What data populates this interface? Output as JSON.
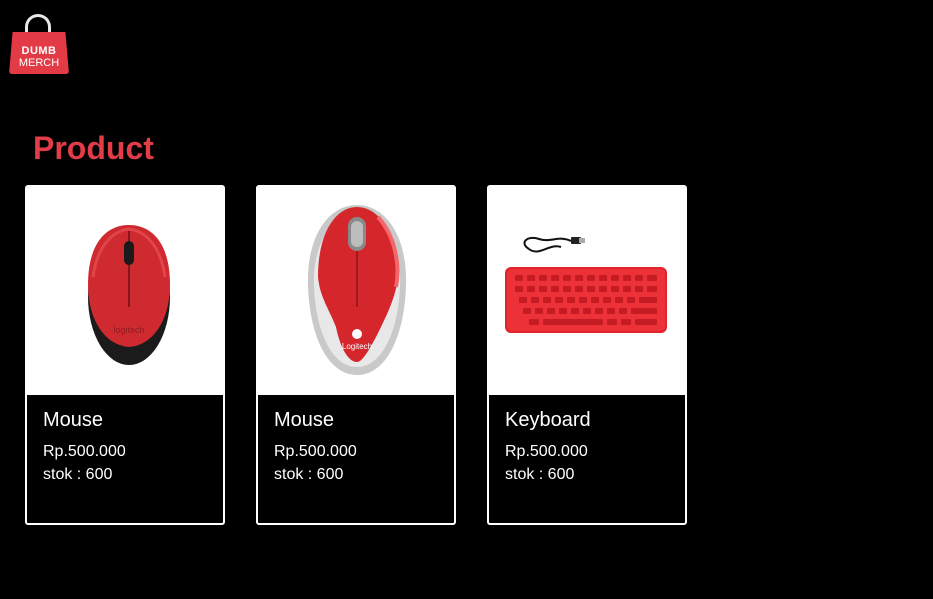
{
  "brand": {
    "line1": "DUMB",
    "line2": "MERCH",
    "color": "#e33b45"
  },
  "section": {
    "title": "Product",
    "title_color": "#e23c46"
  },
  "products": [
    {
      "name": "Mouse",
      "price": "Rp.500.000",
      "stock": "stok : 600",
      "image": "mouse-image",
      "image_brand": "logitech"
    },
    {
      "name": "Mouse",
      "price": "Rp.500.000",
      "stock": "stok : 600",
      "image": "mouse-image",
      "image_brand": "Logitech"
    },
    {
      "name": "Keyboard",
      "price": "Rp.500.000",
      "stock": "stok : 600",
      "image": "keyboard-image"
    }
  ]
}
